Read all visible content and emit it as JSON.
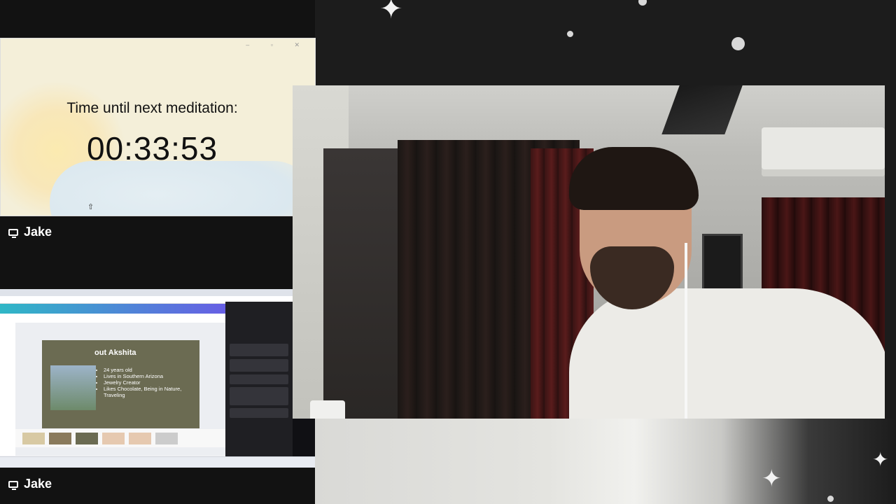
{
  "timer": {
    "title": "Time until next meditation:",
    "value": "00:33:53"
  },
  "participants": [
    {
      "name": "Jake"
    },
    {
      "name": "Jake"
    }
  ],
  "screen_share": {
    "slide_title": "out Akshita",
    "bullets": [
      "24 years old",
      "Lives in Southern Arizona",
      "Jewelry Creator",
      "Likes Chocolate, Being in Nature, Traveling"
    ]
  },
  "icons": [
    "monitor-icon",
    "cursor-icon",
    "sparkle-star-icon"
  ],
  "colors": {
    "timer_bg": "#f4efd9",
    "page_bg": "#1c1c1c",
    "name_text": "#ffffff"
  }
}
